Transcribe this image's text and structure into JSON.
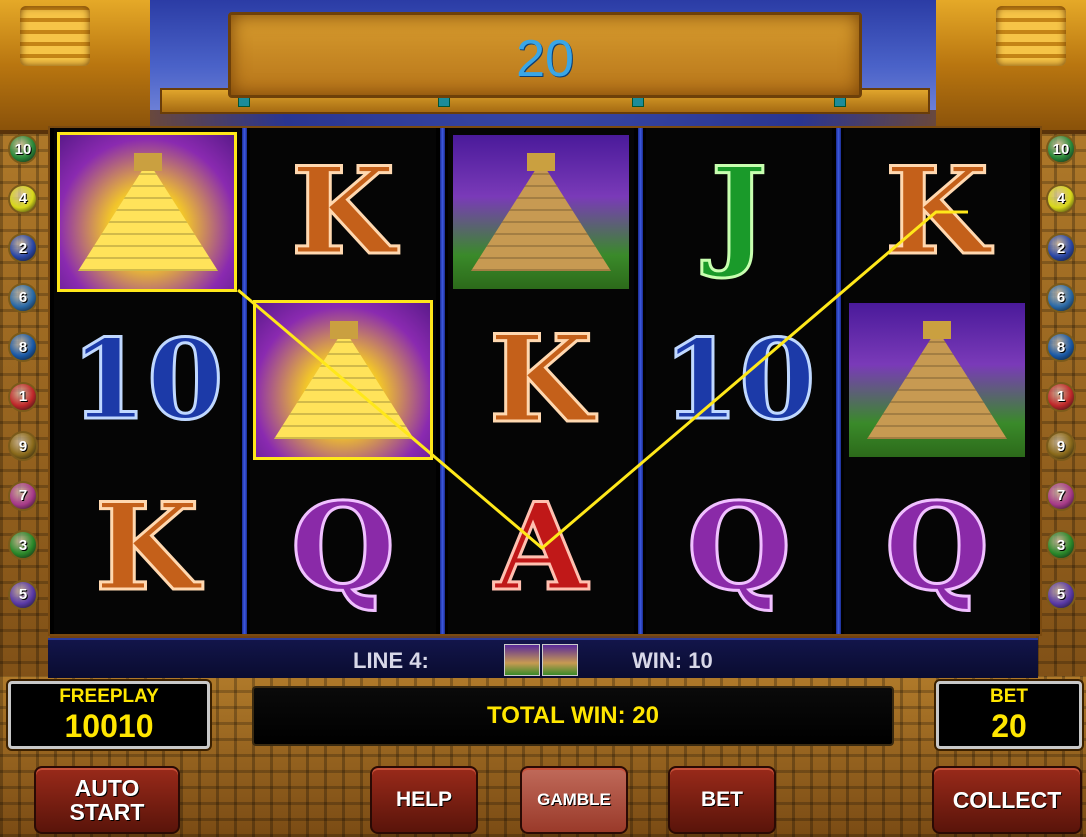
{
  "header": {
    "win_value": "20"
  },
  "paylines": {
    "left": [
      "10",
      "4",
      "2",
      "6",
      "8",
      "1",
      "9",
      "7",
      "3",
      "5"
    ],
    "right": [
      "10",
      "4",
      "2",
      "6",
      "8",
      "1",
      "9",
      "7",
      "3",
      "5"
    ],
    "colors": [
      "#2a8a3a",
      "#d8d81a",
      "#2a48a8",
      "#2a6aa8",
      "#1a5aa8",
      "#c0282a",
      "#8a6a1a",
      "#a83a8a",
      "#2a8a2a",
      "#5a3aa8"
    ]
  },
  "reels": [
    [
      "pyramid-gold",
      "10",
      "K"
    ],
    [
      "K",
      "pyramid-gold",
      "Q"
    ],
    [
      "pyramid",
      "K",
      "A"
    ],
    [
      "J",
      "10",
      "Q"
    ],
    [
      "K",
      "pyramid",
      "Q"
    ]
  ],
  "info_bar": {
    "line_label": "LINE 4:",
    "win_label": "WIN: 10"
  },
  "freeplay": {
    "label": "FREEPLAY",
    "value": "10010"
  },
  "total_win": {
    "label": "TOTAL WIN: 20"
  },
  "bet_panel": {
    "label": "BET",
    "value": "20"
  },
  "buttons": {
    "auto_start": "AUTO\nSTART",
    "help": "HELP",
    "gamble": "GAMBLE",
    "bet": "BET",
    "collect": "COLLECT"
  },
  "accent": {
    "highlight": "#ffe81a",
    "win_digits": "#3aa6e6"
  }
}
